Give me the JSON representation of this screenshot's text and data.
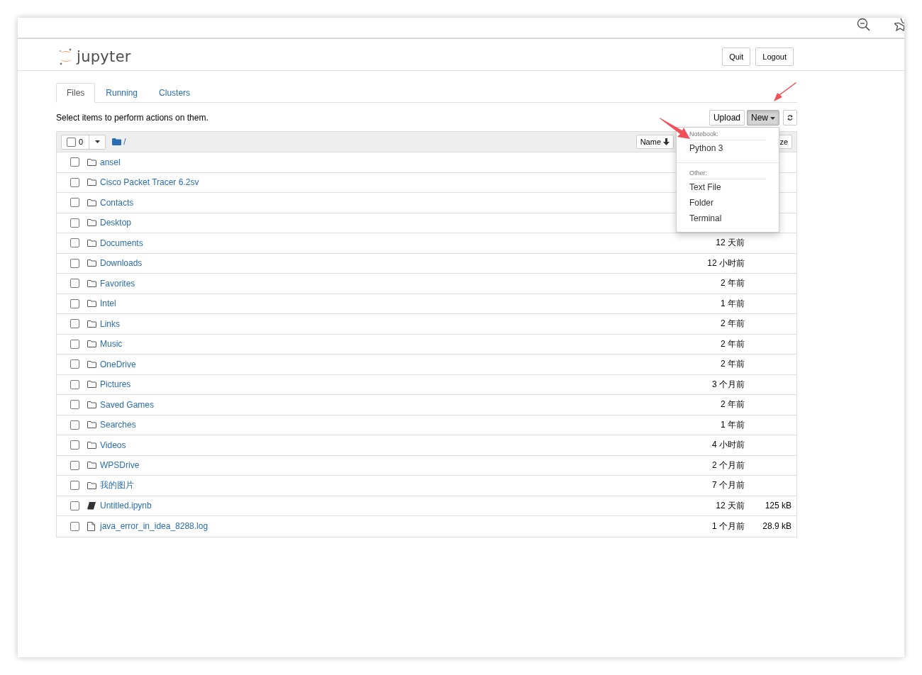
{
  "header": {
    "logo": "jupyter",
    "buttons": [
      "Quit",
      "Logout"
    ]
  },
  "tabs": [
    {
      "label": "Files",
      "selected": true
    },
    {
      "label": "Running",
      "selected": false
    },
    {
      "label": "Clusters",
      "selected": false
    }
  ],
  "toolbar": {
    "hint": "Select items to perform actions on them.",
    "buttons": [
      {
        "label": "Upload",
        "selected": false
      },
      {
        "label": "New",
        "selected": true
      }
    ]
  },
  "new_menu": {
    "sections": [
      {
        "header": "Notebook:",
        "items": [
          "Python 3"
        ]
      },
      {
        "header": "Other:",
        "items": [
          "Text File",
          "Folder",
          "Terminal"
        ]
      }
    ]
  },
  "list_header": {
    "all_checked": false,
    "selected_count": "0",
    "path": "/",
    "sort_buttons": [
      "Name",
      "ze"
    ]
  },
  "rows": [
    {
      "kind": "folder",
      "name": "ansel",
      "checked": false
    },
    {
      "kind": "folder",
      "name": "Cisco Packet Tracer 6.2sv",
      "checked": false
    },
    {
      "kind": "folder",
      "name": "Contacts",
      "checked": false
    },
    {
      "kind": "folder",
      "name": "Desktop",
      "checked": false
    },
    {
      "kind": "folder",
      "name": "Documents",
      "modified": "12 天前",
      "checked": false
    },
    {
      "kind": "folder",
      "name": "Downloads",
      "modified": "12 小时前",
      "checked": false
    },
    {
      "kind": "folder",
      "name": "Favorites",
      "modified": "2 年前",
      "checked": false
    },
    {
      "kind": "folder",
      "name": "Intel",
      "modified": "1 年前",
      "checked": false
    },
    {
      "kind": "folder",
      "name": "Links",
      "modified": "2 年前",
      "checked": false
    },
    {
      "kind": "folder",
      "name": "Music",
      "modified": "2 年前",
      "checked": false
    },
    {
      "kind": "folder",
      "name": "OneDrive",
      "modified": "2 年前",
      "checked": false
    },
    {
      "kind": "folder",
      "name": "Pictures",
      "modified": "3 个月前",
      "checked": false
    },
    {
      "kind": "folder",
      "name": "Saved Games",
      "modified": "2 年前",
      "checked": false
    },
    {
      "kind": "folder",
      "name": "Searches",
      "modified": "1 年前",
      "checked": false
    },
    {
      "kind": "folder",
      "name": "Videos",
      "modified": "4 小时前",
      "checked": false
    },
    {
      "kind": "folder",
      "name": "WPSDrive",
      "modified": "2 个月前",
      "checked": false
    },
    {
      "kind": "folder",
      "name": "我的图片",
      "modified": "7 个月前",
      "checked": false
    },
    {
      "kind": "notebook",
      "name": "Untitled.ipynb",
      "modified": "12 天前",
      "size": "125 kB",
      "checked": false
    },
    {
      "kind": "file",
      "name": "java_error_in_idea_8288.log",
      "modified": "1 个月前",
      "size": "28.9 kB",
      "checked": false
    }
  ]
}
